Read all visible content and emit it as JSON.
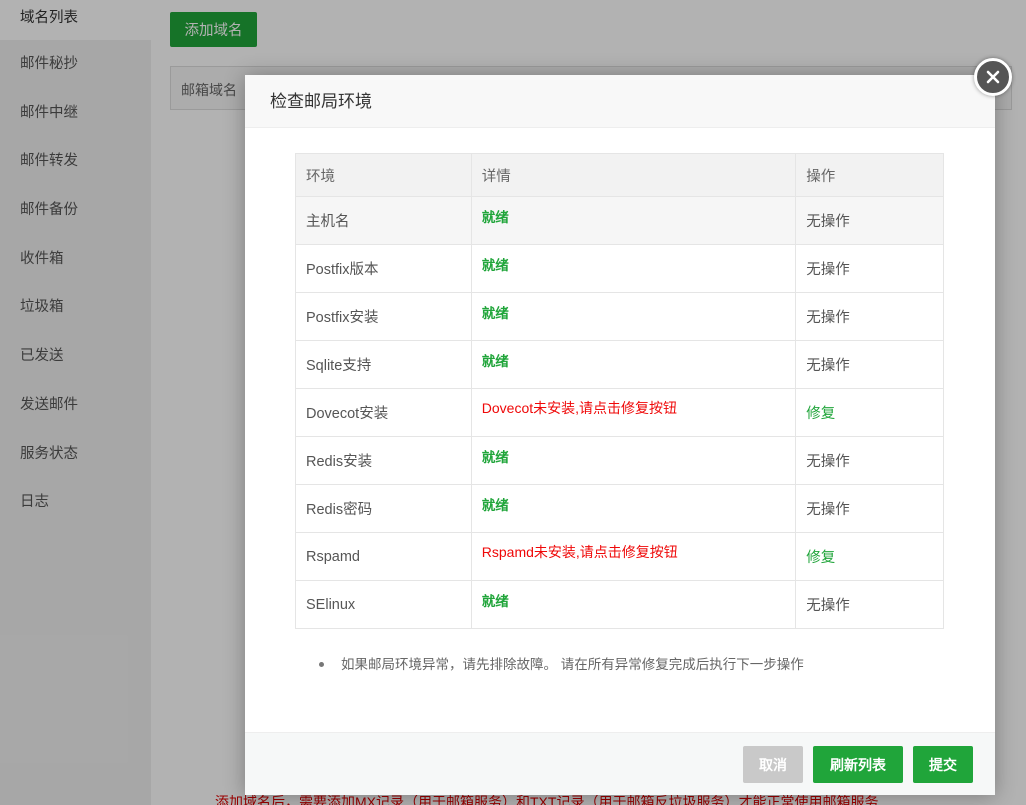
{
  "sidebar": {
    "items": [
      {
        "label": "域名列表"
      },
      {
        "label": "邮件秘抄"
      },
      {
        "label": "邮件中继"
      },
      {
        "label": "邮件转发"
      },
      {
        "label": "邮件备份"
      },
      {
        "label": "收件箱"
      },
      {
        "label": "垃圾箱"
      },
      {
        "label": "已发送"
      },
      {
        "label": "发送邮件"
      },
      {
        "label": "服务状态"
      },
      {
        "label": "日志"
      }
    ]
  },
  "main": {
    "add_domain_label": "添加域名",
    "table_first_header": "邮箱域名",
    "bottom_note": "添加域名后，需要添加MX记录（用于邮箱服务）和TXT记录（用于邮箱反垃圾服务）才能正常使用邮箱服务"
  },
  "dialog": {
    "title": "检查邮局环境",
    "close_icon": "close-icon",
    "table": {
      "headers": [
        "环境",
        "详情",
        "操作"
      ],
      "rows": [
        {
          "env": "主机名",
          "detail": "就绪",
          "status": "ok",
          "op": "无操作"
        },
        {
          "env": "Postfix版本",
          "detail": "就绪",
          "status": "ok",
          "op": "无操作"
        },
        {
          "env": "Postfix安装",
          "detail": "就绪",
          "status": "ok",
          "op": "无操作"
        },
        {
          "env": "Sqlite支持",
          "detail": "就绪",
          "status": "ok",
          "op": "无操作"
        },
        {
          "env": "Dovecot安装",
          "detail": "Dovecot未安装,请点击修复按钮",
          "status": "error",
          "op": "修复"
        },
        {
          "env": "Redis安装",
          "detail": "就绪",
          "status": "ok",
          "op": "无操作"
        },
        {
          "env": "Redis密码",
          "detail": "就绪",
          "status": "ok",
          "op": "无操作"
        },
        {
          "env": "Rspamd",
          "detail": "Rspamd未安装,请点击修复按钮",
          "status": "error",
          "op": "修复"
        },
        {
          "env": "SElinux",
          "detail": "就绪",
          "status": "ok",
          "op": "无操作"
        }
      ]
    },
    "tip": "如果邮局环境异常，请先排除故障。 请在所有异常修复完成后执行下一步操作",
    "footer": {
      "cancel_label": "取消",
      "refresh_label": "刷新列表",
      "submit_label": "提交"
    }
  },
  "colors": {
    "accent": "#20a53a",
    "error": "#ef0808",
    "disabled": "#c9c9c9"
  }
}
